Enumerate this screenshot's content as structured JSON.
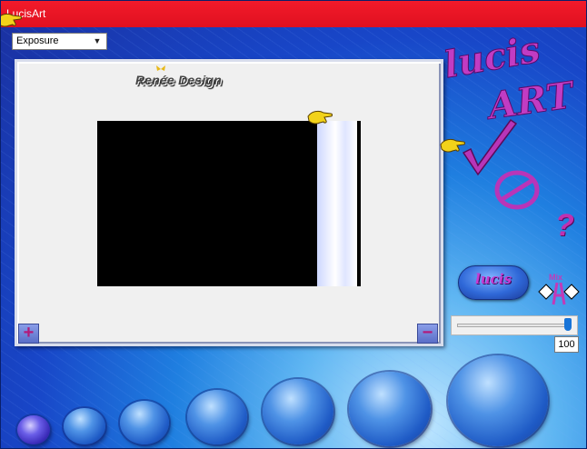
{
  "window": {
    "title": "LucisArt"
  },
  "toolbar": {
    "effect_select_value": "Exposure"
  },
  "preview": {
    "brand_text": "Renée Design"
  },
  "logo": {
    "text_top": "lucis",
    "text_bottom": "ART"
  },
  "actions": {
    "help_symbol": "?",
    "lucis_button_label": "lucis",
    "mix_label": "Mix"
  },
  "slider": {
    "value": 100,
    "value_text": "100",
    "max": 100
  },
  "colors": {
    "titlebar": "#e8141f",
    "accent_magenta": "#c23ab8",
    "background_blue": "#1a3fb0"
  },
  "icons": [
    "pointer-hand-icon",
    "ok-check-icon",
    "cancel-icon",
    "help-icon",
    "mix-icon",
    "zoom-in-icon",
    "zoom-out-icon"
  ]
}
